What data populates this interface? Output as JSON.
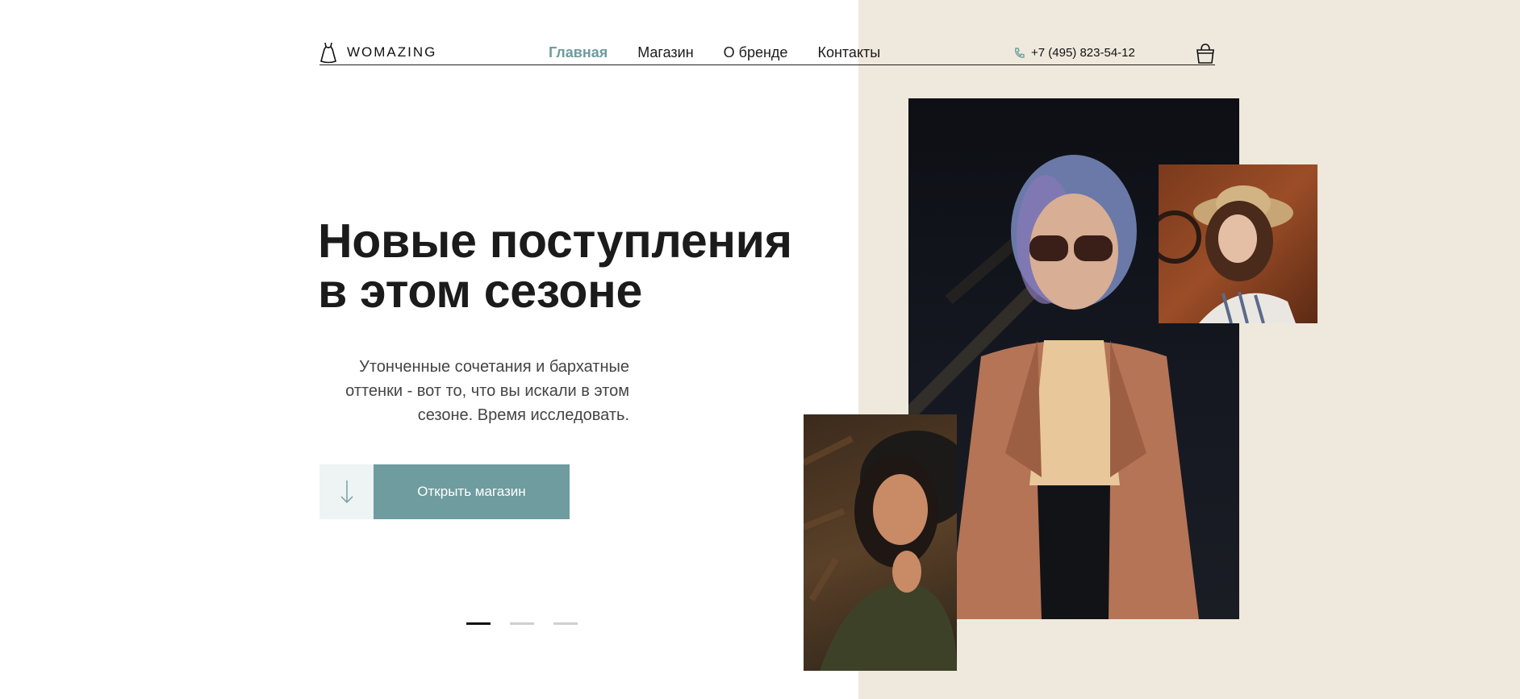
{
  "brand": {
    "name": "WOMAZING"
  },
  "nav": {
    "items": [
      {
        "label": "Главная",
        "active": true
      },
      {
        "label": "Магазин",
        "active": false
      },
      {
        "label": "О бренде",
        "active": false
      },
      {
        "label": "Контакты",
        "active": false
      }
    ]
  },
  "header": {
    "phone": "+7 (495) 823-54-12"
  },
  "hero": {
    "title_line1": "Новые поступления",
    "title_line2": "в этом сезоне",
    "subtitle": "Утонченные сочетания и бархатные оттенки - вот то, что вы искали в этом сезоне. Время исследовать.",
    "cta_label": "Открыть магазин"
  },
  "slider": {
    "count": 3,
    "active_index": 0
  },
  "colors": {
    "accent": "#6e9c9f",
    "beige_panel": "#efe8dc",
    "arrow_bg": "#eef3f3",
    "text": "#1b1b1b"
  },
  "icons": {
    "logo": "dress-icon",
    "phone": "phone-icon",
    "cart": "shopping-bag-icon",
    "cta": "arrow-down-icon"
  }
}
